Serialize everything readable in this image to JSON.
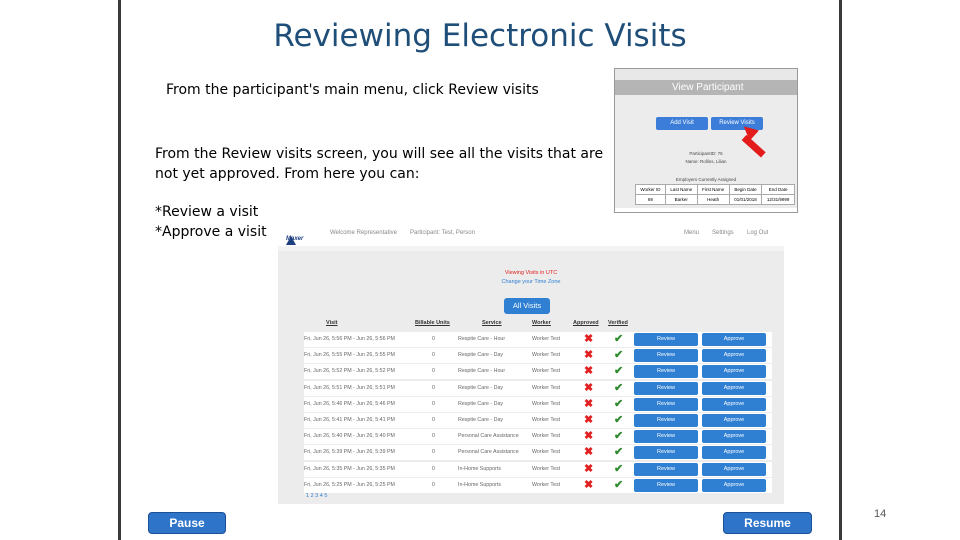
{
  "slide": {
    "title": "Reviewing Electronic Visits",
    "text1": "From the participant's main menu, click Review visits",
    "text2_line1": "From the Review visits screen, you will see all the visits that are",
    "text2_line2": "not yet approved. From here you can:",
    "bullet1": "*Review a visit",
    "bullet2": "*Approve a visit",
    "page_number": "14"
  },
  "controls": {
    "pause_label": "Pause",
    "resume_label": "Resume"
  },
  "view_participant": {
    "header": "View Participant",
    "add_visit": "Add Visit",
    "review_visits": "Review Visits",
    "participant_id": "ParticipantID: 75",
    "name": "Name: Rollins, Lilian",
    "employers_heading": "Employers Currently Assigned",
    "columns": [
      "Worker ID",
      "Last Name",
      "First Name",
      "Begin Date",
      "End Date"
    ],
    "row": [
      "69",
      "Barker",
      "Heath",
      "01/01/2018",
      "12/31/9999"
    ]
  },
  "review_screen": {
    "logo": "Maxer",
    "nav_welcome": "Welcome Representative",
    "nav_participant": "Participant: Test, Person",
    "nav_menu": "Menu",
    "nav_settings": "Settings",
    "nav_logout": "Log Out",
    "utc_text": "Viewing Visits in UTC",
    "change_tz": "Change your Time Zone",
    "all_visits": "All Visits",
    "columns": [
      "Visit",
      "Billable Units",
      "Service",
      "Worker",
      "Approved",
      "Verified"
    ],
    "review_label": "Review",
    "approve_label": "Approve",
    "pager": "1 2 3 4 5",
    "rows": [
      {
        "visit": "Fri, Jun 26, 5:56 PM  - Jun 26, 5:56 PM",
        "units": "0",
        "service": "Respite Care - Hour",
        "worker": "Worker  Test"
      },
      {
        "visit": "Fri, Jun 26, 5:55 PM  - Jun 26, 5:55 PM",
        "units": "0",
        "service": "Respite Care - Day",
        "worker": "Worker  Test"
      },
      {
        "visit": "Fri, Jun 26, 5:52 PM  - Jun 26, 5:52 PM",
        "units": "0",
        "service": "Respite Care - Hour",
        "worker": "Worker  Test"
      },
      {
        "visit": "Fri, Jun 26, 5:51 PM  - Jun 26, 5:51 PM",
        "units": "0",
        "service": "Respite Care - Day",
        "worker": "Worker  Test"
      },
      {
        "visit": "Fri, Jun 26, 5:46 PM  - Jun 26, 5:46 PM",
        "units": "0",
        "service": "Respite Care - Day",
        "worker": "Worker  Test"
      },
      {
        "visit": "Fri, Jun 26, 5:41 PM  - Jun 26, 5:41 PM",
        "units": "0",
        "service": "Respite Care - Day",
        "worker": "Worker  Test"
      },
      {
        "visit": "Fri, Jun 26, 5:40 PM  - Jun 26, 5:40 PM",
        "units": "0",
        "service": "Personal Care Assistance",
        "worker": "Worker  Test"
      },
      {
        "visit": "Fri, Jun 26, 5:39 PM  - Jun 26, 5:39 PM",
        "units": "0",
        "service": "Personal Care Assistance",
        "worker": "Worker  Test"
      },
      {
        "visit": "Fri, Jun 26, 5:35 PM  - Jun 26, 5:35 PM",
        "units": "0",
        "service": "In-Home Supports",
        "worker": "Worker  Test"
      },
      {
        "visit": "Fri, Jun 26, 5:25 PM  - Jun 26, 5:25 PM",
        "units": "0",
        "service": "In-Home Supports",
        "worker": "Worker  Test"
      }
    ]
  },
  "colors": {
    "title": "#1f4e79",
    "button_blue": "#2e74c9",
    "reject_red": "#e02020",
    "verified_green": "#2e8b2e"
  },
  "icons": {
    "not_approved": "x-mark-icon",
    "verified": "check-mark-icon",
    "pointer": "red-arrow-icon"
  }
}
